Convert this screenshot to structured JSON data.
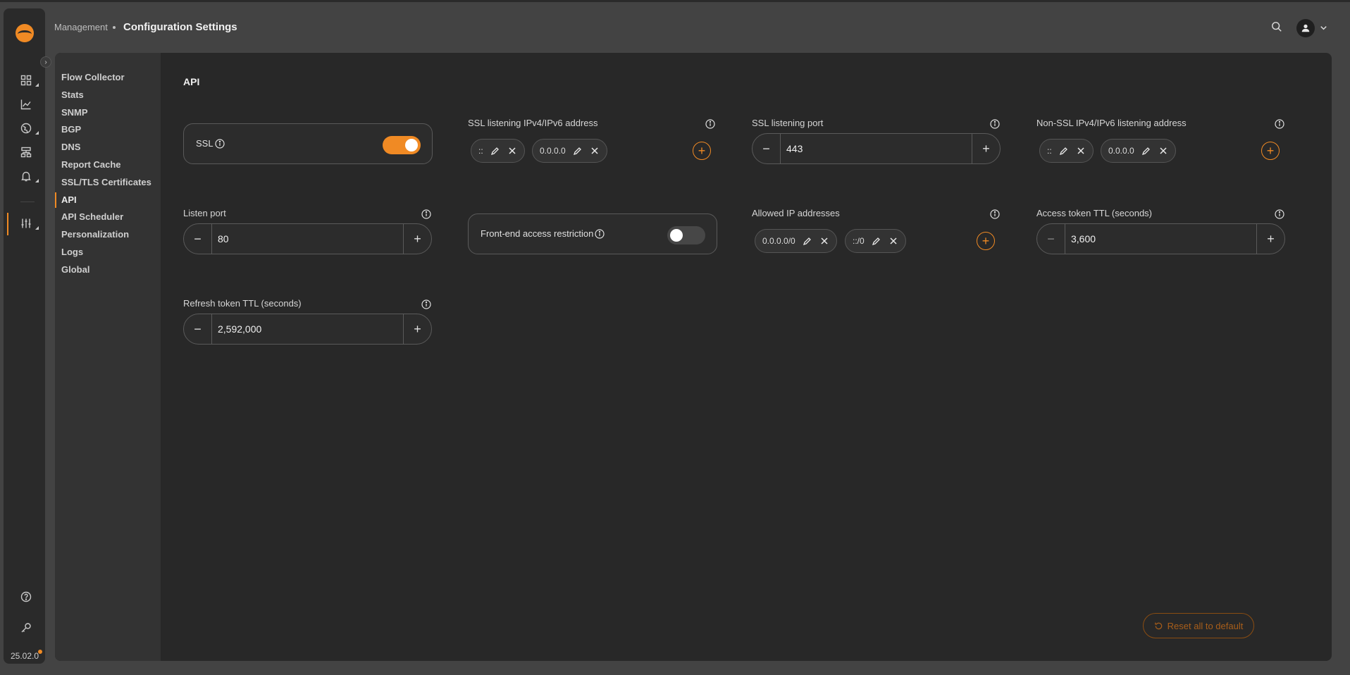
{
  "header": {
    "breadcrumb_parent": "Management",
    "title": "Configuration Settings"
  },
  "rail": {
    "version": "25.02.0",
    "icons": [
      "dashboard-icon",
      "chart-icon",
      "globe-icon",
      "hierarchy-icon",
      "bell-icon",
      "sliders-icon",
      "help-icon",
      "key-icon"
    ]
  },
  "subnav": {
    "items": [
      "Flow Collector",
      "Stats",
      "SNMP",
      "BGP",
      "DNS",
      "Report Cache",
      "SSL/TLS Certificates",
      "API",
      "API Scheduler",
      "Personalization",
      "Logs",
      "Global"
    ],
    "active": "API"
  },
  "section": {
    "title": "API"
  },
  "fields": {
    "ssl": {
      "label": "SSL",
      "enabled": true
    },
    "ssl_listening_address": {
      "label": "SSL listening IPv4/IPv6 address",
      "chips": [
        "::",
        "0.0.0.0"
      ]
    },
    "ssl_listening_port": {
      "label": "SSL listening port",
      "value": "443"
    },
    "non_ssl_address": {
      "label": "Non-SSL IPv4/IPv6 listening address",
      "chips": [
        "::",
        "0.0.0.0"
      ]
    },
    "listen_port": {
      "label": "Listen port",
      "value": "80"
    },
    "frontend_restriction": {
      "label": "Front-end access restriction",
      "enabled": false
    },
    "allowed_ips": {
      "label": "Allowed IP addresses",
      "chips": [
        "0.0.0.0/0",
        "::/0"
      ]
    },
    "access_token_ttl": {
      "label": "Access token TTL (seconds)",
      "value": "3,600"
    },
    "refresh_token_ttl": {
      "label": "Refresh token TTL (seconds)",
      "value": "2,592,000"
    }
  },
  "actions": {
    "reset_label": "Reset all to default"
  },
  "colors": {
    "accent": "#f08a24",
    "background": "#434343",
    "card": "#282828"
  }
}
